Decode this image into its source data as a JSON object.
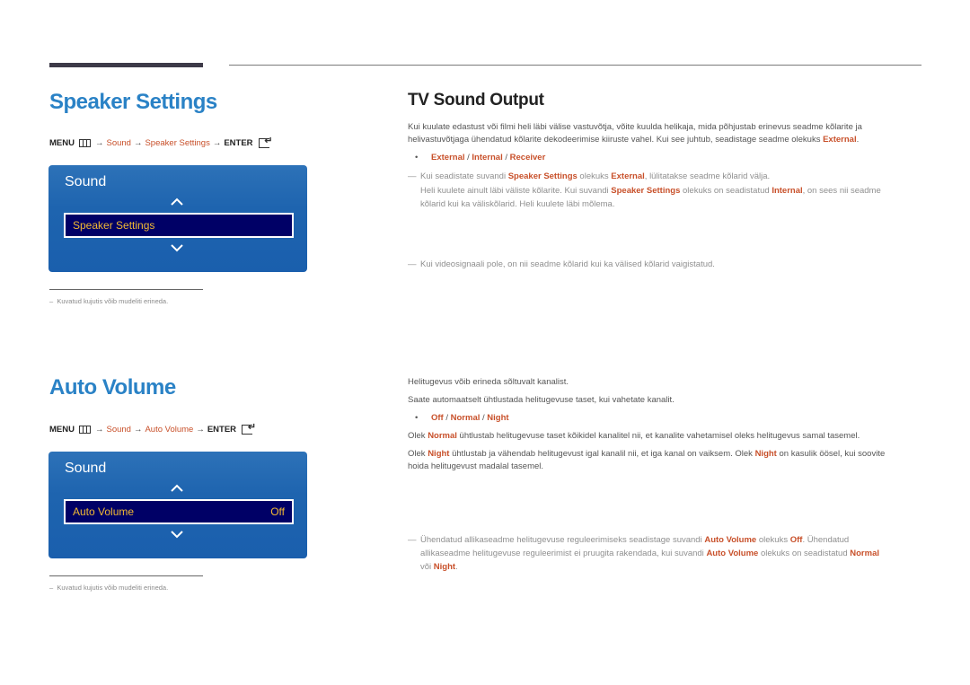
{
  "sections": [
    {
      "title": "Speaker Settings",
      "menu_path": {
        "menu_label": "MENU",
        "arrow": "→",
        "step1": "Sound",
        "step2": "Speaker Settings",
        "enter_label": "ENTER"
      },
      "osd": {
        "title": "Sound",
        "item_label": "Speaker Settings",
        "item_value": ""
      },
      "footnote": "Kuvatud kujutis võib mudeliti erineda."
    },
    {
      "title": "Auto Volume",
      "menu_path": {
        "menu_label": "MENU",
        "arrow": "→",
        "step1": "Sound",
        "step2": "Auto Volume",
        "enter_label": "ENTER"
      },
      "osd": {
        "title": "Sound",
        "item_label": "Auto Volume",
        "item_value": "Off"
      },
      "footnote": "Kuvatud kujutis võib mudeliti erineda."
    }
  ],
  "tv_sound_output": {
    "title": "TV Sound Output",
    "intro_1": "Kui kuulate edastust või filmi heli läbi välise vastuvõtja, võite kuulda helikaja, mida põhjustab erinevus seadme kõlarite ja",
    "intro_2": "helivastuvõtjaga ühendatud kõlarite dekodeerimise kiiruste vahel. Kui see juhtub, seadistage seadme olekuks ",
    "intro_2_hl": "External",
    "options": [
      "External",
      "Internal",
      "Receiver"
    ],
    "separator": " / ",
    "note1": {
      "a": "Kui seadistate suvandi ",
      "b": "Speaker Settings",
      "c": " olekuks ",
      "d": "External",
      "e": ", lülitatakse seadme kõlarid välja.",
      "line2_a": "Heli kuulete ainult läbi väliste kõlarite. Kui suvandi ",
      "line2_b": "Speaker Settings",
      "line2_c": " olekuks on seadistatud ",
      "line2_d": "Internal",
      "line2_e": ", on sees nii seadme",
      "line3": "kõlarid kui ka väliskõlarid. Heli kuulete läbi mõlema."
    },
    "note2": "Kui videosignaali pole, on nii seadme kõlarid kui ka välised kõlarid vaigistatud."
  },
  "auto_volume": {
    "p1": "Helitugevus võib erineda sõltuvalt kanalist.",
    "p2": "Saate automaatselt ühtlustada helitugevuse taset, kui vahetate kanalit.",
    "options": [
      "Off",
      "Normal",
      "Night"
    ],
    "separator": " / ",
    "normal_desc": {
      "a": "Olek ",
      "b": "Normal",
      "c": " ühtlustab helitugevuse taset kõikidel kanalitel nii, et kanalite vahetamisel oleks helitugevus samal tasemel."
    },
    "night_desc": {
      "a": "Olek ",
      "b": "Night",
      "c": " ühtlustab ja vähendab helitugevust igal kanalil nii, et iga kanal on vaiksem. Olek ",
      "d": "Night",
      "e": " on kasulik öösel, kui soovite",
      "line2": "hoida helitugevust madalal tasemel."
    },
    "note": {
      "a": "Ühendatud allikaseadme helitugevuse reguleerimiseks seadistage suvandi ",
      "b": "Auto Volume",
      "c": " olekuks ",
      "d": "Off",
      "e": ". Ühendatud",
      "line2_a": "allikaseadme helitugevuse reguleerimist ei pruugita rakendada, kui suvandi ",
      "line2_b": "Auto Volume",
      "line2_c": " olekuks on seadistatud ",
      "line2_d": "Normal",
      "line3_a": "või ",
      "line3_b": "Night",
      "line3_c": "."
    }
  },
  "colors": {
    "heading_blue": "#2a82c6",
    "highlight_orange": "#c8502a",
    "osd_blue": "#1e64af",
    "osd_selected_bg": "#000066",
    "osd_selected_text": "#f2b934"
  }
}
